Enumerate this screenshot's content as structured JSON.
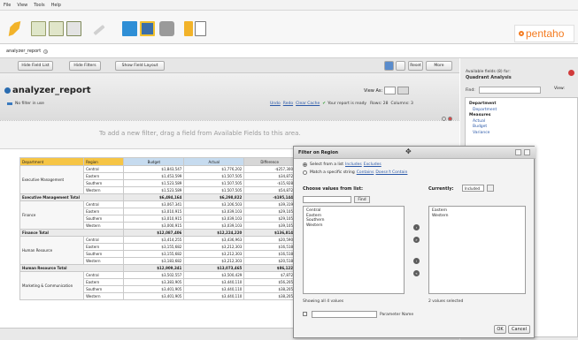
{
  "menu": [
    "File",
    "View",
    "Tools",
    "Help"
  ],
  "toolbar": {
    "icons": [
      "new-report-icon",
      "open-icon",
      "save-icon",
      "edit-pencil-icon",
      "chart-icon",
      "print-icon",
      "layout-icon"
    ],
    "logo": "pentaho"
  },
  "tab": {
    "label": "analyzer_report"
  },
  "report_toolbar": {
    "hide_field_list": "Hide Field List",
    "hide_filters": "Hide Filters",
    "show_field_layout": "Show Field Layout",
    "reset": "Reset",
    "more": "More"
  },
  "report": {
    "title": "analyzer_report",
    "view_as": "View As:",
    "no_filter": "No filter in use",
    "status_links": [
      "Undo",
      "Redo",
      "Clear Cache"
    ],
    "status_ready": "Your report is ready",
    "rows": "Rows: 28",
    "columns": "Columns: 3",
    "dropzone_msg": "To add a new filter, drag a field from Available Fields to this area."
  },
  "grid": {
    "headers": [
      "Department",
      "Region",
      "Budget",
      "Actual",
      "Difference"
    ],
    "groups": [
      {
        "dept": "Executive Management",
        "rows": [
          [
            "Central",
            "$1,843,547",
            "$1,776,202",
            "-$257,300"
          ],
          [
            "Eastern",
            "$1,453,599",
            "$1,507,505",
            "$34,872"
          ],
          [
            "Southern",
            "$1,523,589",
            "$1,507,505",
            "-$15,928"
          ],
          [
            "Western",
            "$1,523,589",
            "$1,507,505",
            "$54,872"
          ]
        ],
        "total": [
          "Executive Management Total",
          "$6,494,164",
          "$6,298,822",
          "-$195,144"
        ]
      },
      {
        "dept": "Finance",
        "rows": [
          [
            "Central",
            "$3,067,341",
            "$3,106,503",
            "$39,319"
          ],
          [
            "Eastern",
            "$3,010,915",
            "$3,039,103",
            "$29,105"
          ],
          [
            "Southern",
            "$3,010,915",
            "$3,039,103",
            "$29,105"
          ],
          [
            "Western",
            "$3,000,915",
            "$3,039,103",
            "$39,105"
          ]
        ],
        "total": [
          "Finance Total",
          "$12,087,406",
          "$12,224,220",
          "$136,814"
        ]
      },
      {
        "dept": "Human Resource",
        "rows": [
          [
            "Central",
            "$3,414,255",
            "$3,436,963",
            "$20,590"
          ],
          [
            "Eastern",
            "$3,155,682",
            "$3,212,303",
            "$16,518"
          ],
          [
            "Southern",
            "$3,155,682",
            "$3,212,303",
            "$16,518"
          ],
          [
            "Western",
            "$3,183,682",
            "$3,212,303",
            "$20,518"
          ]
        ],
        "total": [
          "Human Resource Total",
          "$12,909,341",
          "$13,073,465",
          "$86,122"
        ]
      },
      {
        "dept": "Marketing & Communication",
        "rows": [
          [
            "Central",
            "$3,502,557",
            "$3,500,429",
            "$7,872"
          ],
          [
            "Eastern",
            "$3,383,905",
            "$3,440,110",
            "$56,205"
          ],
          [
            "Southern",
            "$3,401,905",
            "$3,440,110",
            "$38,205"
          ],
          [
            "Western",
            "$3,401,905",
            "$3,440,110",
            "$38,205"
          ]
        ]
      }
    ]
  },
  "side_panel": {
    "heading": "Available fields (8) for:",
    "cube": "Quadrant Analysis",
    "find": "Find:",
    "view": "View:",
    "tree": [
      {
        "group": "Department",
        "items": [
          "Department"
        ]
      },
      {
        "group": "Measures",
        "items": [
          "Actual",
          "Budget",
          "Variance"
        ]
      }
    ]
  },
  "dialog": {
    "title": "Filter on Region",
    "opt1": "Select from a list",
    "opt1_links": [
      "Includes",
      "Excludes"
    ],
    "opt2": "Match a specific string",
    "opt2_links": [
      "Contains",
      "Doesn't Contain"
    ],
    "choose": "Choose values from list:",
    "find_btn": "Find",
    "currently": "Currently:",
    "currently_select": "Included",
    "available": [
      "Central",
      "Eastern",
      "Southern",
      "Western"
    ],
    "selected": [
      "Eastern",
      "Western"
    ],
    "showing": "Showing all 4 values",
    "selected_count": "2 values selected",
    "param_label": "Parameter Name",
    "ok": "OK",
    "cancel": "Cancel"
  }
}
